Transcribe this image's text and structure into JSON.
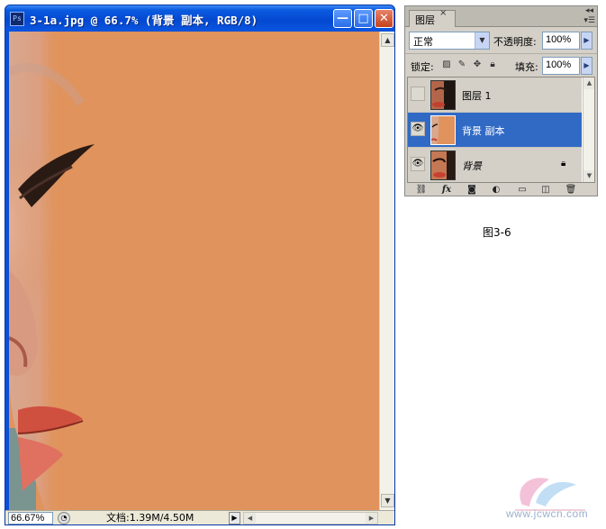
{
  "document_window": {
    "app_icon_text": "Ps",
    "title": "3-1a.jpg @ 66.7% (背景 副本, RGB/8)",
    "buttons": {
      "minimize": "—",
      "maximize": "□",
      "close": "✕"
    },
    "status_bar": {
      "zoom": "66.67%",
      "doc_info": "文档:1.39M/4.50M"
    },
    "canvas_fill_color": "#e0935c"
  },
  "layers_panel": {
    "tab_label": "图层",
    "tab_close": "×",
    "blend_mode": "正常",
    "opacity_label": "不透明度:",
    "opacity_value": "100%",
    "lock_label": "锁定:",
    "fill_label": "填充:",
    "fill_value": "100%",
    "layers": [
      {
        "name": "图层 1",
        "visible": false,
        "selected": false
      },
      {
        "name": "背景 副本",
        "visible": true,
        "selected": true
      },
      {
        "name": "背景",
        "visible": true,
        "selected": false,
        "locked": true
      }
    ],
    "footer_icons": [
      "link-icon",
      "fx-icon",
      "mask-icon",
      "adjustment-icon",
      "group-folder-icon",
      "new-layer-icon",
      "trash-icon"
    ],
    "footer_fx_text": "fx"
  },
  "caption": "图3-6",
  "watermark": "www.jcwcn.com"
}
